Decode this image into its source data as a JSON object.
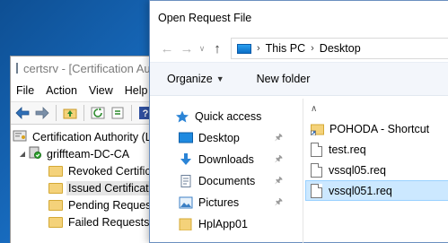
{
  "certsrv": {
    "title": "certsrv - [Certification Authority (Local)\\griffteam-DC-CA\\Issued Certificates]",
    "menu": [
      "File",
      "Action",
      "View",
      "Help"
    ],
    "tree": {
      "root": "Certification Authority (Local)",
      "ca": "griffteam-DC-CA",
      "folders": [
        "Revoked Certificates",
        "Issued Certificates",
        "Pending Requests",
        "Failed Requests"
      ],
      "selected_index": 1
    }
  },
  "dialog": {
    "title": "Open Request File",
    "breadcrumb": [
      "This PC",
      "Desktop"
    ],
    "commands": {
      "organize": "Organize",
      "new_folder": "New folder"
    },
    "nav": {
      "quick_access": "Quick access",
      "items": [
        "Desktop",
        "Downloads",
        "Documents",
        "Pictures",
        "HplApp01"
      ]
    },
    "files": [
      {
        "name": "POHODA - Shortcut",
        "icon": "folder-shortcut-icon"
      },
      {
        "name": "test.req",
        "icon": "file-icon"
      },
      {
        "name": "vssql05.req",
        "icon": "file-icon"
      },
      {
        "name": "vssql051.req",
        "icon": "file-icon"
      }
    ],
    "selected_file_index": 3
  },
  "colors": {
    "selection": "#cce8ff",
    "accent": "#0078d7",
    "folder": "#f4d27a"
  }
}
